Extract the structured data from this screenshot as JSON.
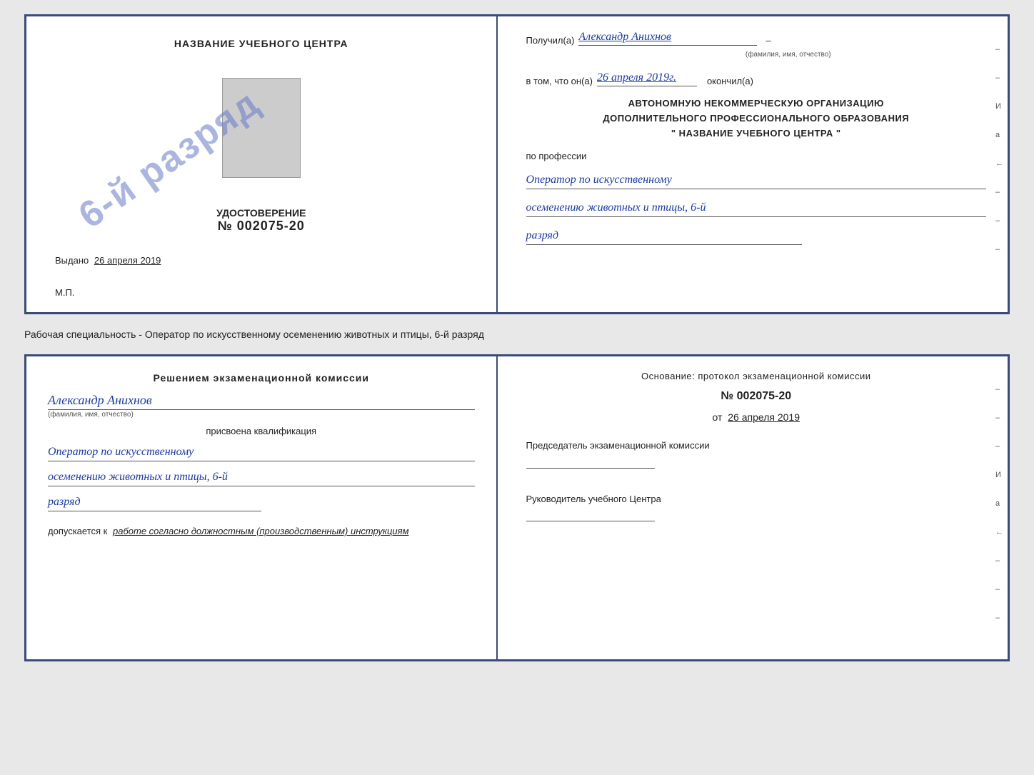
{
  "topDoc": {
    "leftSide": {
      "centerTitle": "НАЗВАНИЕ УЧЕБНОГО ЦЕНТРА",
      "stampText": "6-й разряд",
      "udostLabel": "УДОСТОВЕРЕНИЕ",
      "udostNumber": "№ 002075-20",
      "vydanoLabel": "Выдано",
      "vydanoDate": "26 апреля 2019",
      "mpLabel": "М.П."
    },
    "rightSide": {
      "poluchilLabel": "Получил(а)",
      "poluchilName": "Александр Анихнов",
      "nameSubLabel": "(фамилия, имя, отчество)",
      "vtomLabel": "в том, что он(а)",
      "vtomDate": "26 апреля 2019г.",
      "okonchilLabel": "окончил(а)",
      "orgLine1": "АВТОНОМНУЮ НЕКОММЕРЧЕСКУЮ ОРГАНИЗАЦИЮ",
      "orgLine2": "ДОПОЛНИТЕЛЬНОГО ПРОФЕССИОНАЛЬНОГО ОБРАЗОВАНИЯ",
      "orgLine3": "\" НАЗВАНИЕ УЧЕБНОГО ЦЕНТРА \"",
      "proLabel": "по профессии",
      "proValue1": "Оператор по искусственному",
      "proValue2": "осеменению животных и птицы, 6-й",
      "proValue3": "разряд"
    }
  },
  "subtitle": "Рабочая специальность - Оператор по искусственному осеменению животных и птицы, 6-й разряд",
  "bottomDoc": {
    "leftSide": {
      "decisionTitle": "Решением экзаменационной комиссии",
      "personName": "Александр Анихнов",
      "personSubLabel": "(фамилия, имя, отчество)",
      "assignLabel": "присвоена квалификация",
      "qualValue1": "Оператор по искусственному",
      "qualValue2": "осеменению животных и птицы, 6-й",
      "qualValue3": "разряд",
      "dopuskaetsyaLabel": "допускается к",
      "dopuskaetsyaValue": "работе согласно должностным (производственным) инструкциям"
    },
    "rightSide": {
      "osnovLabel": "Основание: протокол экзаменационной комиссии",
      "protocolNumber": "№ 002075-20",
      "protocolDatePrefix": "от",
      "protocolDate": "26 апреля 2019",
      "chairmanLabel": "Председатель экзаменационной комиссии",
      "rukovLabel": "Руководитель учебного Центра"
    }
  }
}
